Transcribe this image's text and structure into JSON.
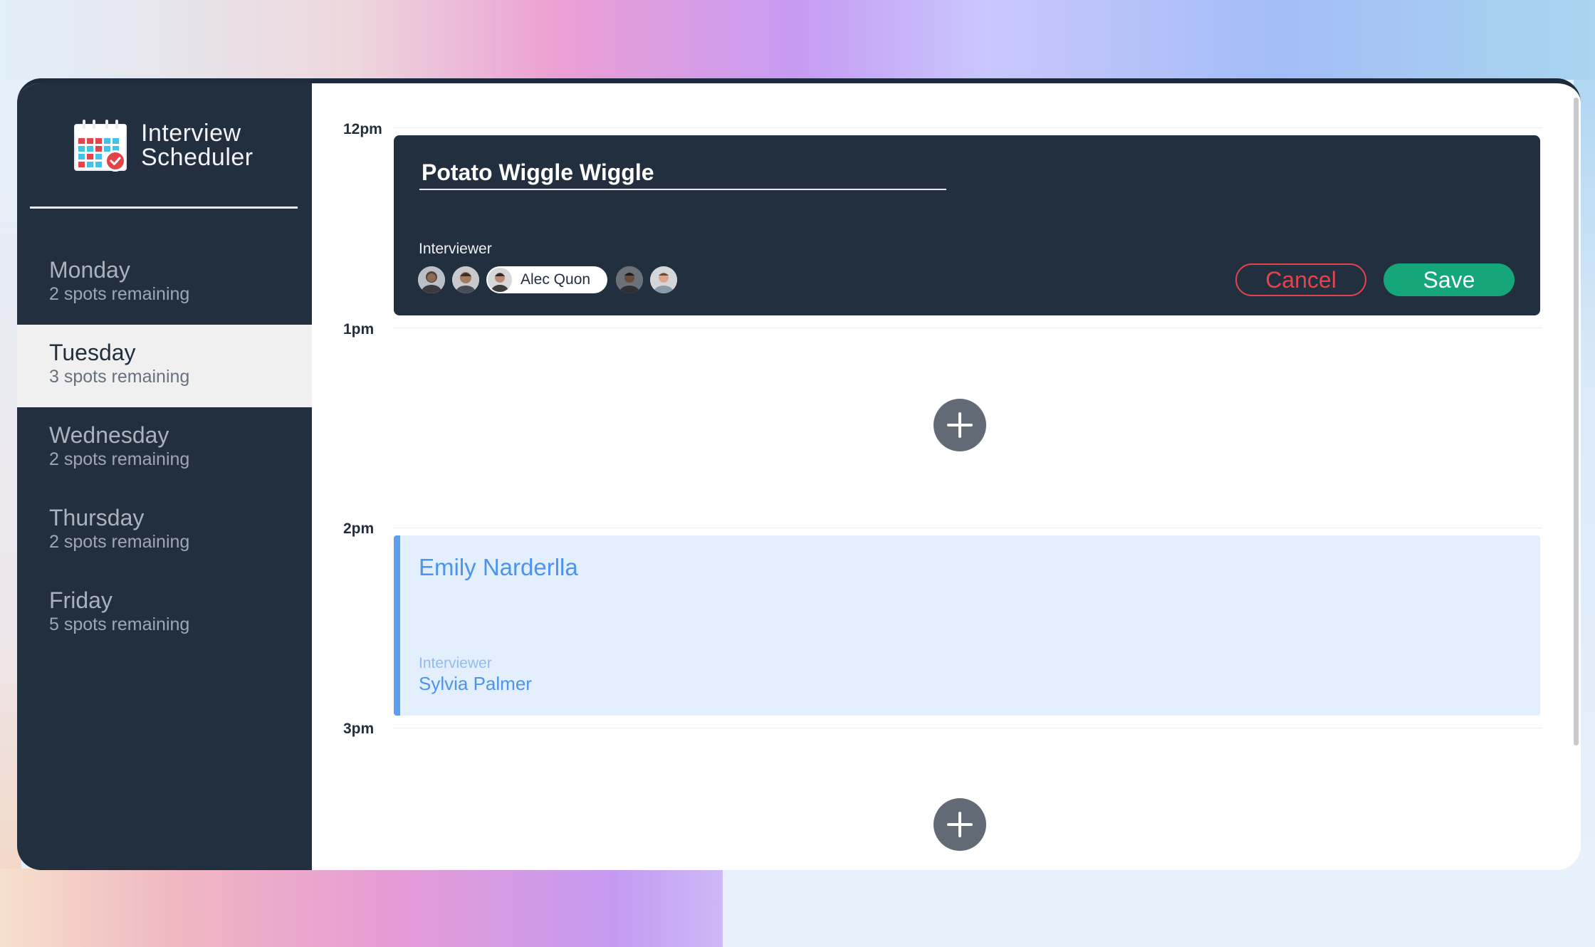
{
  "app": {
    "title_line1": "Interview",
    "title_line2": "Scheduler",
    "icon": "calendar-check-icon"
  },
  "sidebar": {
    "selected_index": 1,
    "days": [
      {
        "name": "Monday",
        "spots": "2 spots remaining"
      },
      {
        "name": "Tuesday",
        "spots": "3 spots remaining"
      },
      {
        "name": "Wednesday",
        "spots": "2 spots remaining"
      },
      {
        "name": "Thursday",
        "spots": "2 spots remaining"
      },
      {
        "name": "Friday",
        "spots": "5 spots remaining"
      }
    ]
  },
  "schedule": {
    "times": [
      "12pm",
      "1pm",
      "2pm",
      "3pm"
    ],
    "form": {
      "student_value": "Potato Wiggle Wiggle",
      "interviewer_label": "Interviewer",
      "selected_interviewer": "Alec Quon",
      "cancel_label": "Cancel",
      "save_label": "Save"
    },
    "appointment": {
      "student": "Emily Narderlla",
      "interviewer_label": "Interviewer",
      "interviewer": "Sylvia Palmer"
    },
    "add_icon": "plus-icon"
  },
  "colors": {
    "sidebar_bg": "#222f3e",
    "selected_day_bg": "#f0f0f0",
    "cancel": "#e3434b",
    "save": "#15a67a",
    "appointment_accent": "#5b9ff0",
    "appointment_bg": "#e3effd",
    "add_button": "#626a76"
  }
}
